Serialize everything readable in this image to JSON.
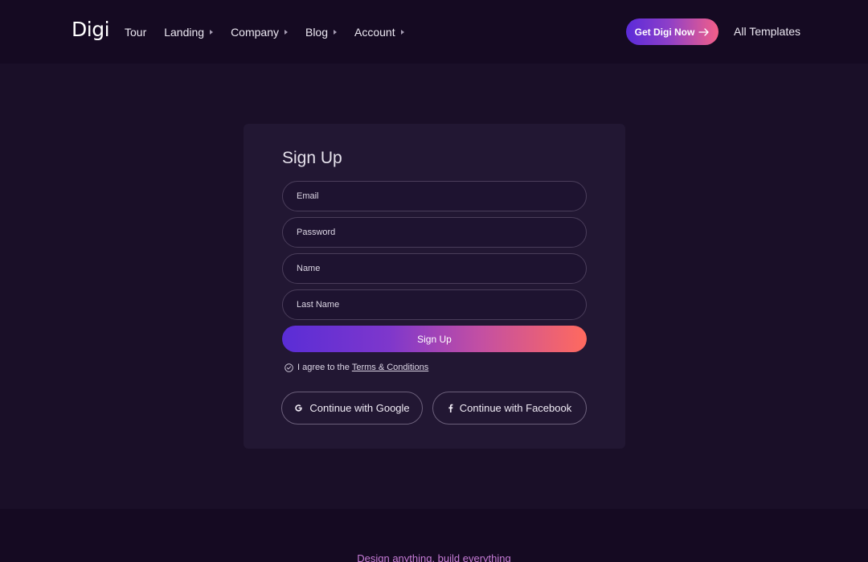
{
  "header": {
    "logo": "Digi",
    "nav": [
      {
        "label": "Tour",
        "has_menu": false
      },
      {
        "label": "Landing",
        "has_menu": true
      },
      {
        "label": "Company",
        "has_menu": true
      },
      {
        "label": "Blog",
        "has_menu": true
      },
      {
        "label": "Account",
        "has_menu": true
      }
    ],
    "cta_label": "Get Digi Now",
    "cta_icon": "arrow-right-icon",
    "all_templates": "All Templates"
  },
  "signup": {
    "title": "Sign Up",
    "fields": {
      "email": {
        "placeholder": "Email",
        "value": ""
      },
      "password": {
        "placeholder": "Password",
        "value": ""
      },
      "name": {
        "placeholder": "Name",
        "value": ""
      },
      "last_name": {
        "placeholder": "Last Name",
        "value": ""
      }
    },
    "submit_label": "Sign Up",
    "agree_text": "I agree to the",
    "terms_label": "Terms & Conditions",
    "google_label": "Continue with Google",
    "facebook_label": "Continue with Facebook"
  },
  "footer": {
    "tagline": "Design anything, build everything"
  },
  "colors": {
    "page_bg": "#1a0f28",
    "header_bg": "#150a22",
    "card_bg": "#221733",
    "gradient_start": "#5a2dd6",
    "gradient_end": "#ff6a5e",
    "accent_pink": "#c67bd6"
  }
}
